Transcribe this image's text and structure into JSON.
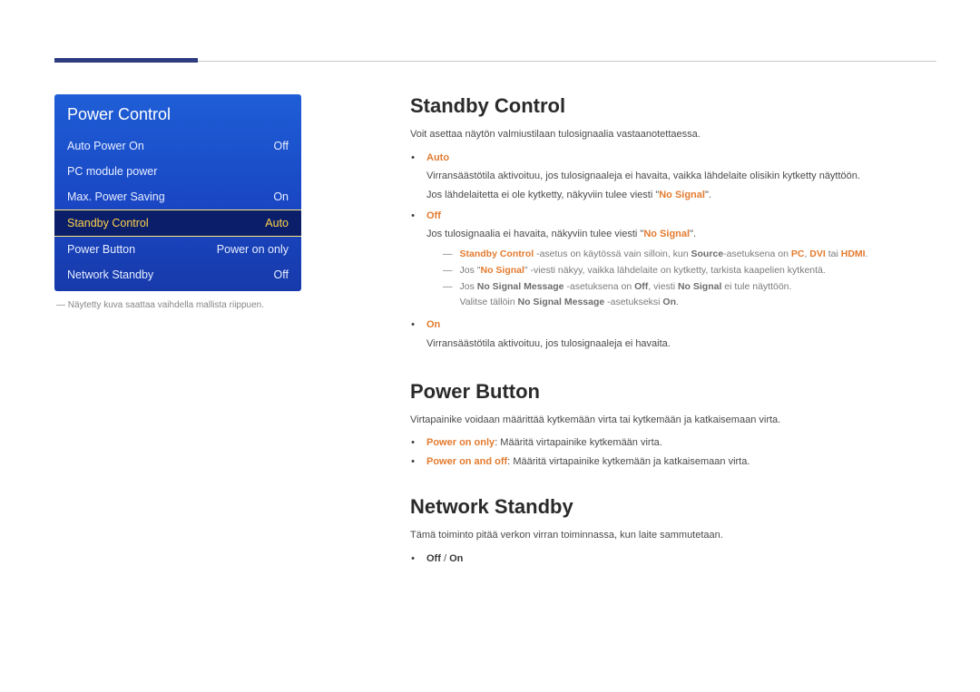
{
  "osd": {
    "title": "Power Control",
    "items": [
      {
        "label": "Auto Power On",
        "value": "Off",
        "highlight": false
      },
      {
        "label": "PC module power",
        "value": "",
        "highlight": false
      },
      {
        "label": "Max. Power Saving",
        "value": "On",
        "highlight": false
      },
      {
        "label": "Standby Control",
        "value": "Auto",
        "highlight": true
      },
      {
        "label": "Power Button",
        "value": "Power on only",
        "highlight": false
      },
      {
        "label": "Network Standby",
        "value": "Off",
        "highlight": false
      }
    ],
    "footnote": "Näytetty kuva saattaa vaihdella mallista riippuen."
  },
  "sections": {
    "standby": {
      "title": "Standby Control",
      "lead": "Voit asettaa näytön valmiustilaan tulosignaalia vastaanotettaessa.",
      "auto": {
        "label": "Auto",
        "line1": "Virransäästötila aktivoituu, jos tulosignaaleja ei havaita, vaikka lähdelaite olisikin kytketty näyttöön.",
        "line2_pre": "Jos lähdelaitetta ei ole kytketty, näkyviin tulee viesti \"",
        "line2_no_signal": "No Signal",
        "line2_post": "\"."
      },
      "off": {
        "label": "Off",
        "line_pre": "Jos tulosignaalia ei havaita, näkyviin tulee viesti \"",
        "line_ns": "No Signal",
        "line_post": "\"."
      },
      "notes": {
        "n1_a": "Standby Control",
        "n1_b": " -asetus on käytössä vain silloin, kun ",
        "n1_c": "Source",
        "n1_d": "-asetuksena on ",
        "n1_e": "PC",
        "n1_f": ", ",
        "n1_g": "DVI",
        "n1_h": " tai ",
        "n1_i": "HDMI",
        "n1_j": ".",
        "n2_pre": "Jos \"",
        "n2_ns": "No Signal",
        "n2_post": "\" -viesti näkyy, vaikka lähdelaite on kytketty, tarkista kaapelien kytkentä.",
        "n3_a": "Jos ",
        "n3_b": "No Signal Message",
        "n3_c": " -asetuksena on ",
        "n3_d": "Off",
        "n3_e": ", viesti ",
        "n3_f": "No Signal",
        "n3_g": " ei tule näyttöön.",
        "n3_line2_a": "Valitse tällöin ",
        "n3_line2_b": "No Signal Message",
        "n3_line2_c": " -asetukseksi ",
        "n3_line2_d": "On",
        "n3_line2_e": "."
      },
      "on": {
        "label": "On",
        "line": "Virransäästötila aktivoituu, jos tulosignaaleja ei havaita."
      }
    },
    "powerbtn": {
      "title": "Power Button",
      "lead": "Virtapainike voidaan määrittää kytkemään virta tai kytkemään ja katkaisemaan virta.",
      "b1_label": "Power on only",
      "b1_text": ": Määritä virtapainike kytkemään virta.",
      "b2_label": "Power on and off",
      "b2_text": ": Määritä virtapainike kytkemään ja katkaisemaan virta."
    },
    "netstandby": {
      "title": "Network Standby",
      "lead": "Tämä toiminto pitää verkon virran toiminnassa, kun laite sammutetaan.",
      "opt_off": "Off",
      "opt_sep": " / ",
      "opt_on": "On"
    }
  }
}
